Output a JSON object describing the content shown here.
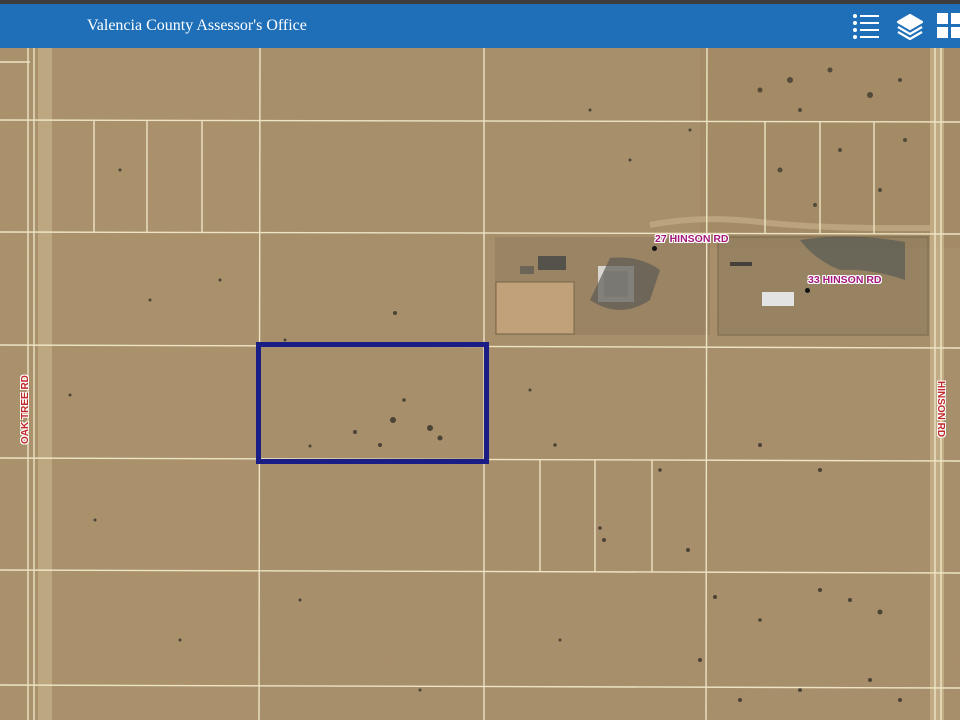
{
  "header": {
    "title": "Valencia County Assessor's Office",
    "accent_color": "#1f6fb8",
    "buttons": [
      {
        "icon": "list-icon"
      },
      {
        "icon": "layers-icon"
      },
      {
        "icon": "grid-icon"
      }
    ]
  },
  "map": {
    "basemap": "aerial imagery",
    "parcel_line_color": "#f3ecd0",
    "selection_color": "#1b1d87",
    "road_label_color": "#c0282a",
    "address_label_color": "#a3177a",
    "addresses": [
      {
        "text": "27 HINSON RD"
      },
      {
        "text": "33 HINSON RD"
      }
    ],
    "roads": [
      {
        "text": "OAK TREE RD"
      },
      {
        "text": "HINSON RD"
      }
    ]
  }
}
